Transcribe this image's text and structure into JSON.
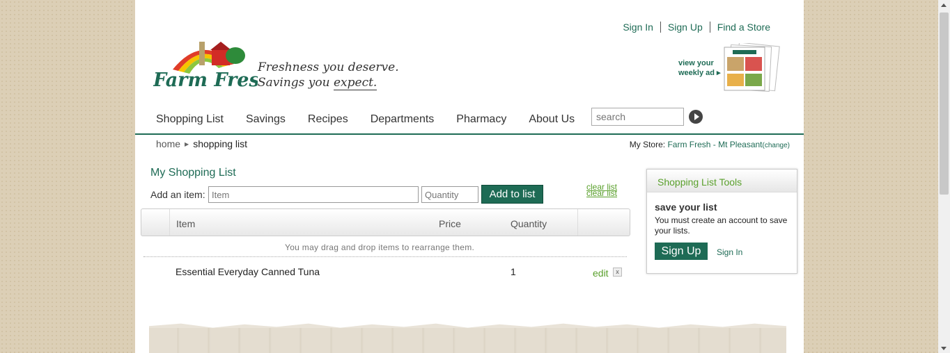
{
  "header": {
    "top_links": [
      "Sign In",
      "Sign Up",
      "Find a Store"
    ],
    "logo_text": "Farm Fresh",
    "tagline_line1": "Freshness you deserve.",
    "tagline_line2_a": "Savings you ",
    "tagline_line2_b": "expect.",
    "weekly_ad_line1": "view your",
    "weekly_ad_line2": "weekly ad ▸"
  },
  "nav": {
    "items": [
      "Shopping List",
      "Savings",
      "Recipes",
      "Departments",
      "Pharmacy",
      "About Us"
    ],
    "search_placeholder": "search"
  },
  "breadcrumb": {
    "home": "home",
    "current": "shopping list"
  },
  "store": {
    "label": "My Store:",
    "name": "Farm Fresh - Mt Pleasant",
    "change": "change"
  },
  "list": {
    "title": "My Shopping List",
    "add_label": "Add an item:",
    "item_placeholder": "Item",
    "qty_placeholder": "Quantity",
    "add_button": "Add to list",
    "clear": "clear list",
    "columns": {
      "item": "Item",
      "price": "Price",
      "quantity": "Quantity"
    },
    "hint": "You may drag and drop items to rearrange them.",
    "rows": [
      {
        "name": "Essential Everyday Canned Tuna",
        "quantity": "1",
        "edit": "edit",
        "remove": "x"
      }
    ]
  },
  "tools": {
    "title": "Shopping List Tools",
    "save_heading": "save your list",
    "save_text": "You must create an account to save your lists.",
    "signup": "Sign Up",
    "signin": "Sign In"
  },
  "colors": {
    "brand_green": "#1e6b55",
    "link_green": "#5aa02c"
  }
}
